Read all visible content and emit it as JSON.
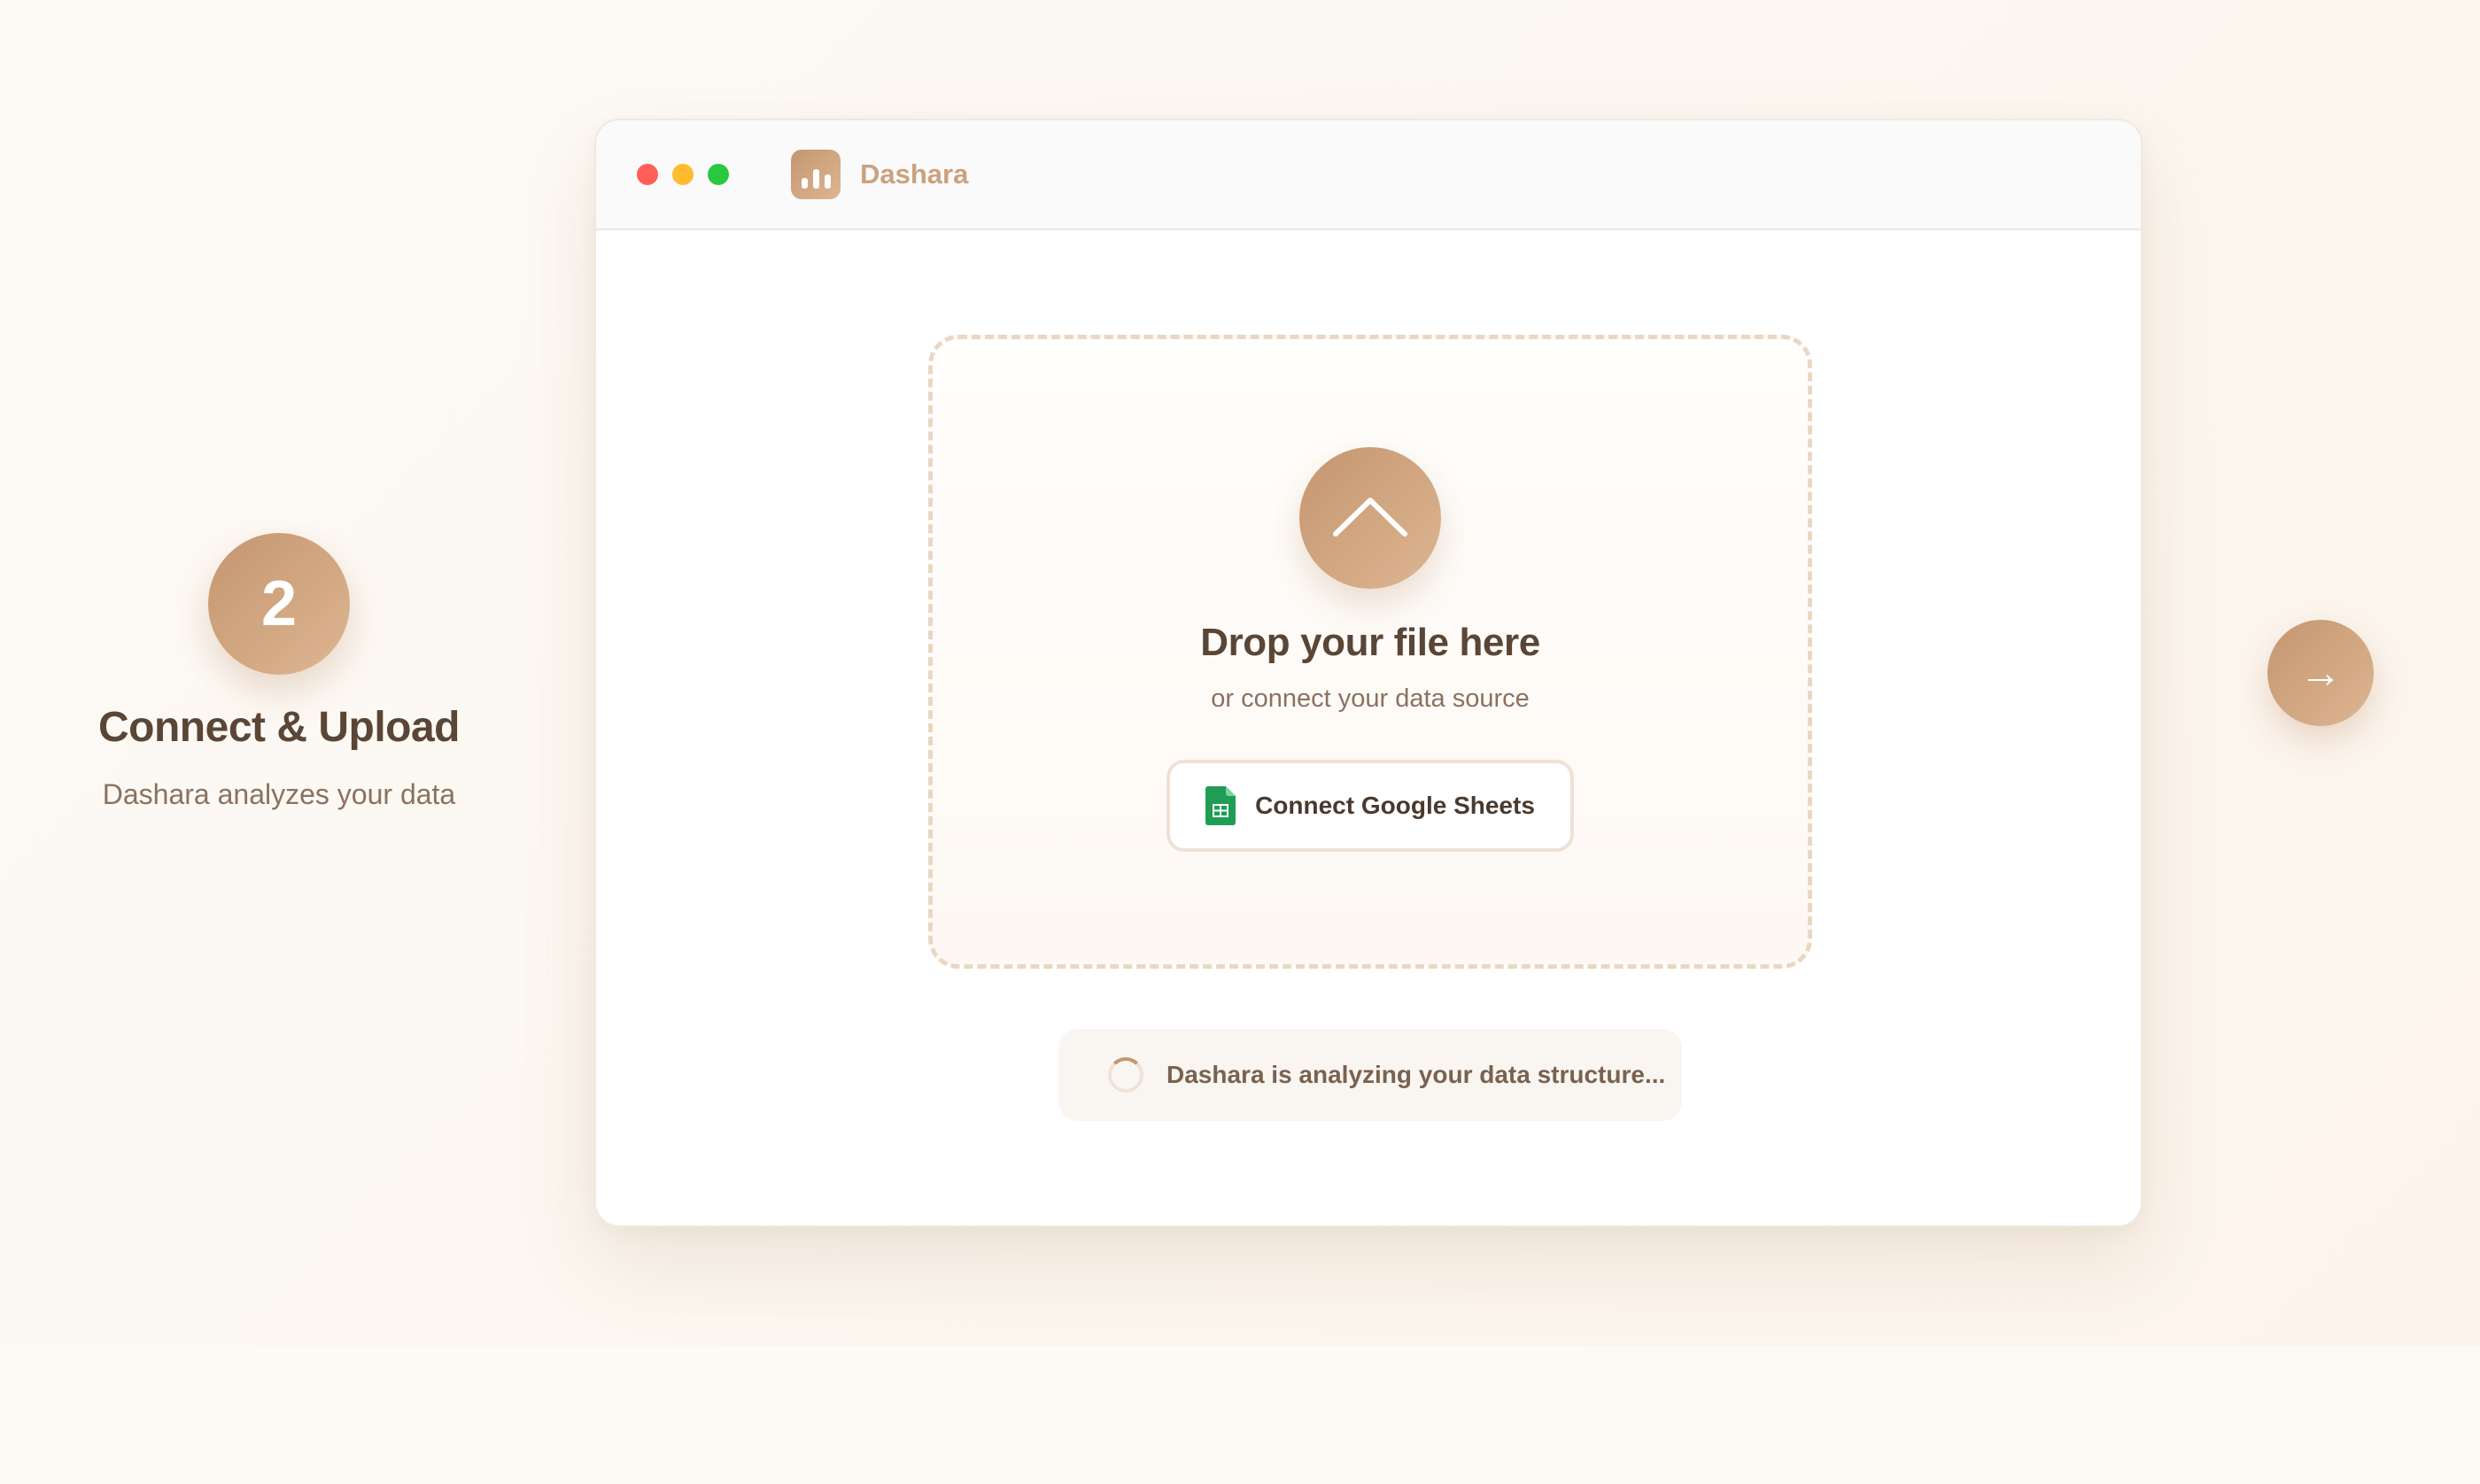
{
  "step": {
    "number": "2",
    "title": "Connect & Upload",
    "description": "Dashara analyzes your data"
  },
  "app": {
    "name": "Dashara",
    "logo_icon": "bar-chart-icon"
  },
  "dropzone": {
    "icon": "chevron-up-icon",
    "title": "Drop your file here",
    "subtitle": "or connect your data source",
    "connect_button": {
      "label": "Connect Google Sheets",
      "icon": "google-sheets-icon"
    }
  },
  "status": {
    "icon": "spinner-icon",
    "text": "Dashara is analyzing your data structure..."
  },
  "navigation": {
    "next_label": "→",
    "next_icon": "arrow-right-icon"
  },
  "colors": {
    "accent_start": "#c49670",
    "accent_end": "#ddb691",
    "heading": "#5a4636",
    "body_text": "#8a7260",
    "sheets_green": "#1f9d55"
  }
}
